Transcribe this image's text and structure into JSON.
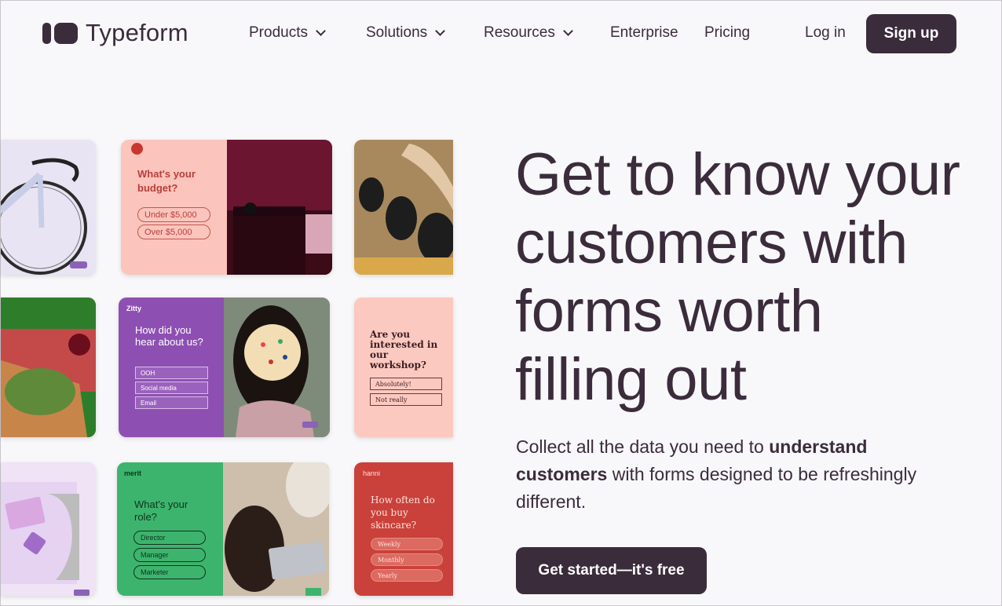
{
  "nav": {
    "brand": "Typeform",
    "items": [
      {
        "label": "Products",
        "has_dropdown": true
      },
      {
        "label": "Solutions",
        "has_dropdown": true
      },
      {
        "label": "Resources",
        "has_dropdown": true
      },
      {
        "label": "Enterprise",
        "has_dropdown": false
      },
      {
        "label": "Pricing",
        "has_dropdown": false
      }
    ],
    "login": "Log in",
    "signup": "Sign up"
  },
  "hero": {
    "headline": "Get to know your customers with forms worth filling out",
    "sub_before": "Collect all the data you need to ",
    "sub_bold1": "understand",
    "sub_space": " ",
    "sub_bold2": "customers",
    "sub_after": " with forms designed to be refreshingly different.",
    "cta": "Get started—it's free"
  },
  "cards": {
    "budget": {
      "question": "What's your budget?",
      "options": [
        "Under $5,000",
        "Over $5,000"
      ]
    },
    "zitty": {
      "brand": "Zitty",
      "question": "How did you hear about us?",
      "options": [
        "OOH",
        "Social media",
        "Email"
      ]
    },
    "workshop": {
      "question": "Are you interested in our workshop?",
      "options": [
        "Absolutely!",
        "Not really"
      ]
    },
    "merit": {
      "brand": "merit",
      "question": "What's your role?",
      "options": [
        "Director",
        "Manager",
        "Marketer"
      ]
    },
    "hanni": {
      "brand": "hanni",
      "question": "How often do you buy skincare?",
      "options": [
        "Weekly",
        "Monthly",
        "Yearly"
      ]
    }
  },
  "colors": {
    "brand": "#3b2c3c",
    "background": "#f8f7fa",
    "budget_card": "#fbc4bd",
    "zitty_card": "#8e4fb3",
    "workshop_card": "#fbc9c0",
    "merit_card": "#3db46d",
    "hanni_card": "#c9413a"
  }
}
